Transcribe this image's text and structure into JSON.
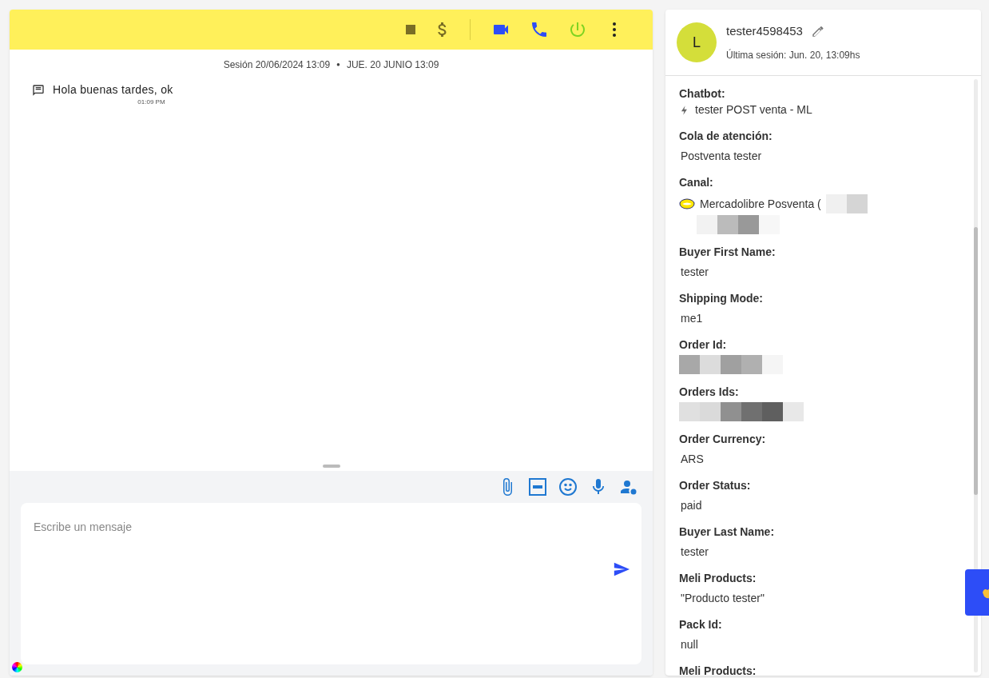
{
  "chat": {
    "session_label": "Sesión 20/06/2024 13:09",
    "session_separator": "●",
    "session_date": "JUE. 20 JUNIO 13:09",
    "messages": [
      {
        "text": "Hola buenas tardes, ok",
        "time": "01:09 PM"
      }
    ],
    "composer": {
      "placeholder": "Escribe un mensaje"
    }
  },
  "contact": {
    "avatar_letter": "L",
    "name": "tester4598453",
    "last_session": "Última sesión: Jun. 20, 13:09hs",
    "fields": [
      {
        "kind": "chatbot",
        "label": "Chatbot:",
        "value": "tester POST venta - ML"
      },
      {
        "kind": "text",
        "label": "Cola de atención:",
        "value": "Postventa tester"
      },
      {
        "kind": "channel",
        "label": "Canal:",
        "value": "Mercadolibre Posventa ("
      },
      {
        "kind": "text",
        "label": "Buyer First Name:",
        "value": "tester"
      },
      {
        "kind": "text",
        "label": "Shipping Mode:",
        "value": "me1"
      },
      {
        "kind": "redacted",
        "label": "Order Id:"
      },
      {
        "kind": "redacted",
        "label": "Orders Ids:"
      },
      {
        "kind": "text",
        "label": "Order Currency:",
        "value": "ARS"
      },
      {
        "kind": "text",
        "label": "Order Status:",
        "value": "paid"
      },
      {
        "kind": "text",
        "label": "Buyer Last Name:",
        "value": "tester"
      },
      {
        "kind": "text",
        "label": "Meli Products:",
        "value": "\"Producto tester\""
      },
      {
        "kind": "text",
        "label": "Pack Id:",
        "value": "null"
      },
      {
        "kind": "label",
        "label": "Meli Products:"
      }
    ]
  }
}
